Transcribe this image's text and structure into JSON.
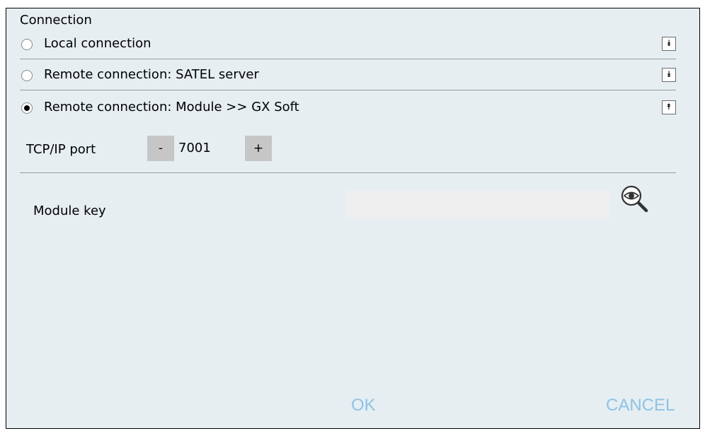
{
  "section": {
    "title": "Connection"
  },
  "connections": [
    {
      "label": "Local connection",
      "selected": false,
      "expander": "down"
    },
    {
      "label": "Remote connection: SATEL server",
      "selected": false,
      "expander": "down"
    },
    {
      "label": "Remote connection: Module >> GX Soft",
      "selected": true,
      "expander": "up"
    }
  ],
  "port": {
    "label": "TCP/IP port",
    "value": "7001",
    "decrement": "-",
    "increment": "+"
  },
  "module_key": {
    "label": "Module key",
    "value": "",
    "icon": "eye-magnifier-icon"
  },
  "actions": {
    "ok": "OK",
    "cancel": "CANCEL"
  },
  "colors": {
    "background": "#e6eef2",
    "action_text": "#8ec3e4",
    "stepper": "#c6c6c6"
  }
}
